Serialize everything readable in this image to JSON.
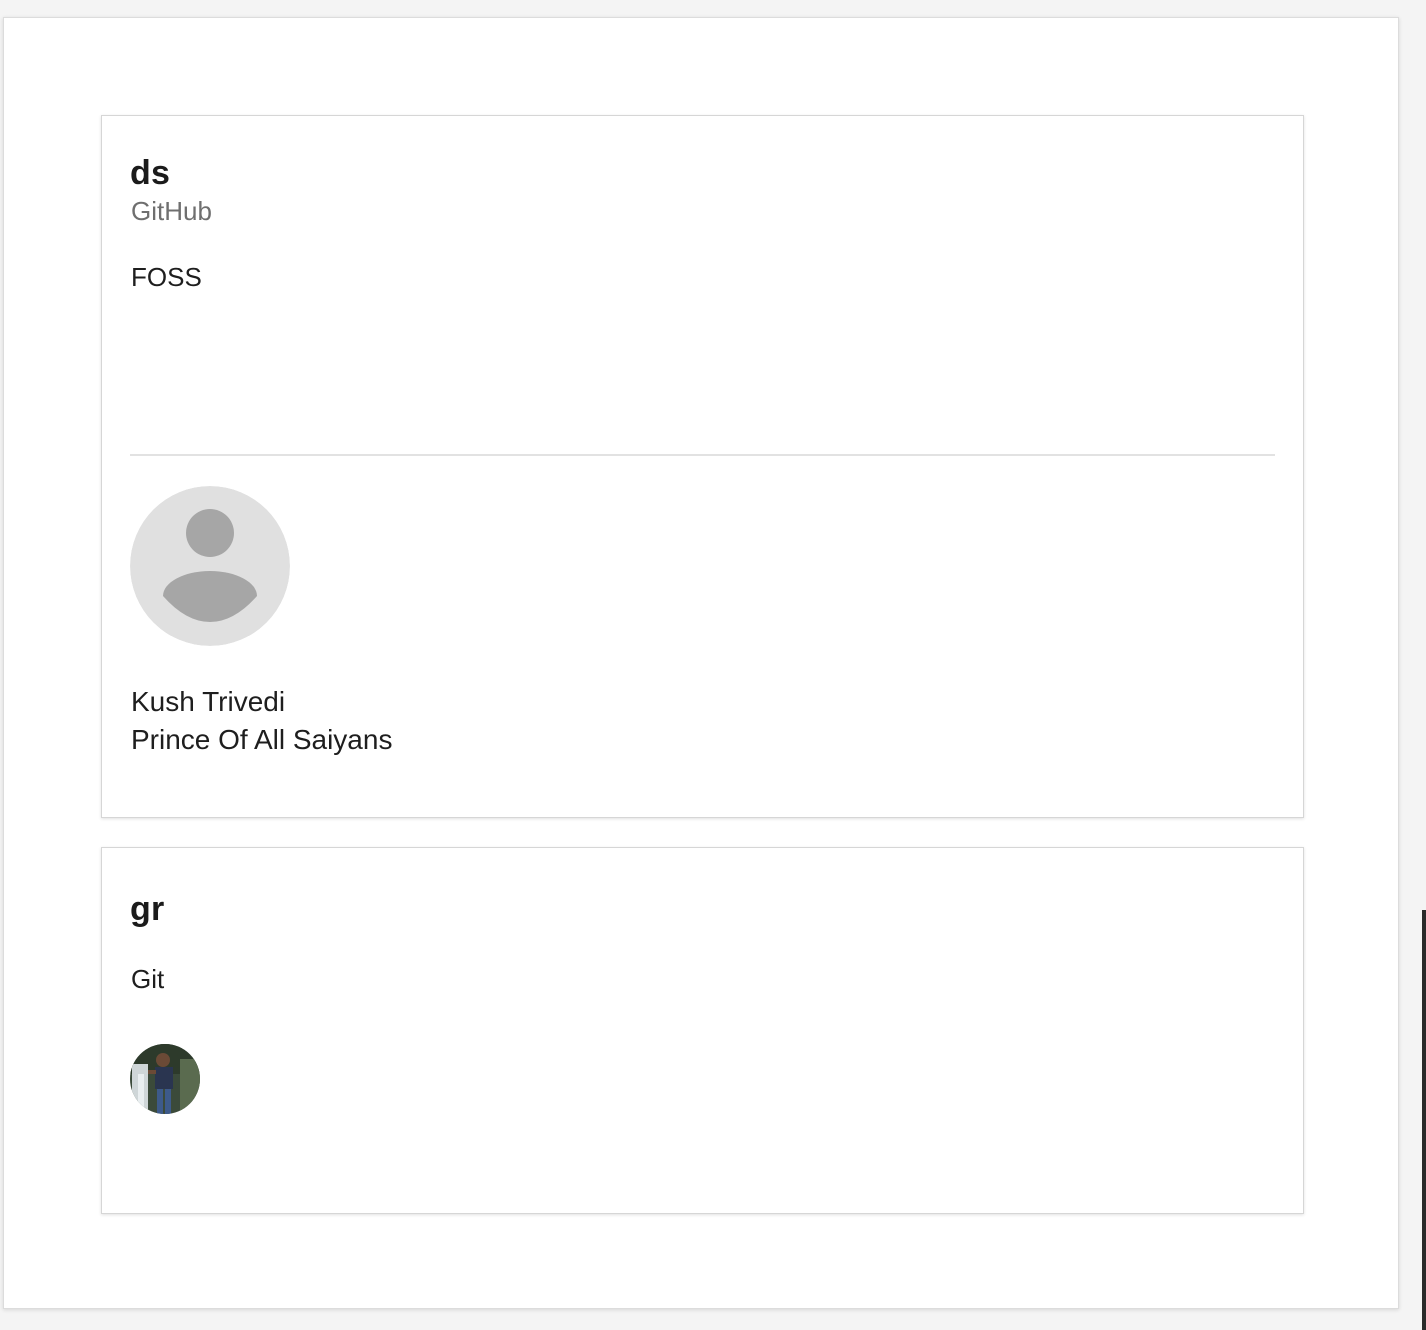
{
  "cards": [
    {
      "title": "ds",
      "subtitle": "GitHub",
      "description": "FOSS",
      "members": [
        {
          "name": "Kush Trivedi",
          "role": "Prince Of All Saiyans",
          "avatar": "default-person-icon"
        }
      ]
    },
    {
      "title": "gr",
      "description": "Git",
      "members": [
        {
          "avatar": "user-photo"
        }
      ]
    }
  ],
  "colors": {
    "title": "#1b1b1b",
    "subtitle": "#6f6f6f",
    "avatar_bg": "#e0e0e0",
    "avatar_fg": "#a6a6a6"
  }
}
